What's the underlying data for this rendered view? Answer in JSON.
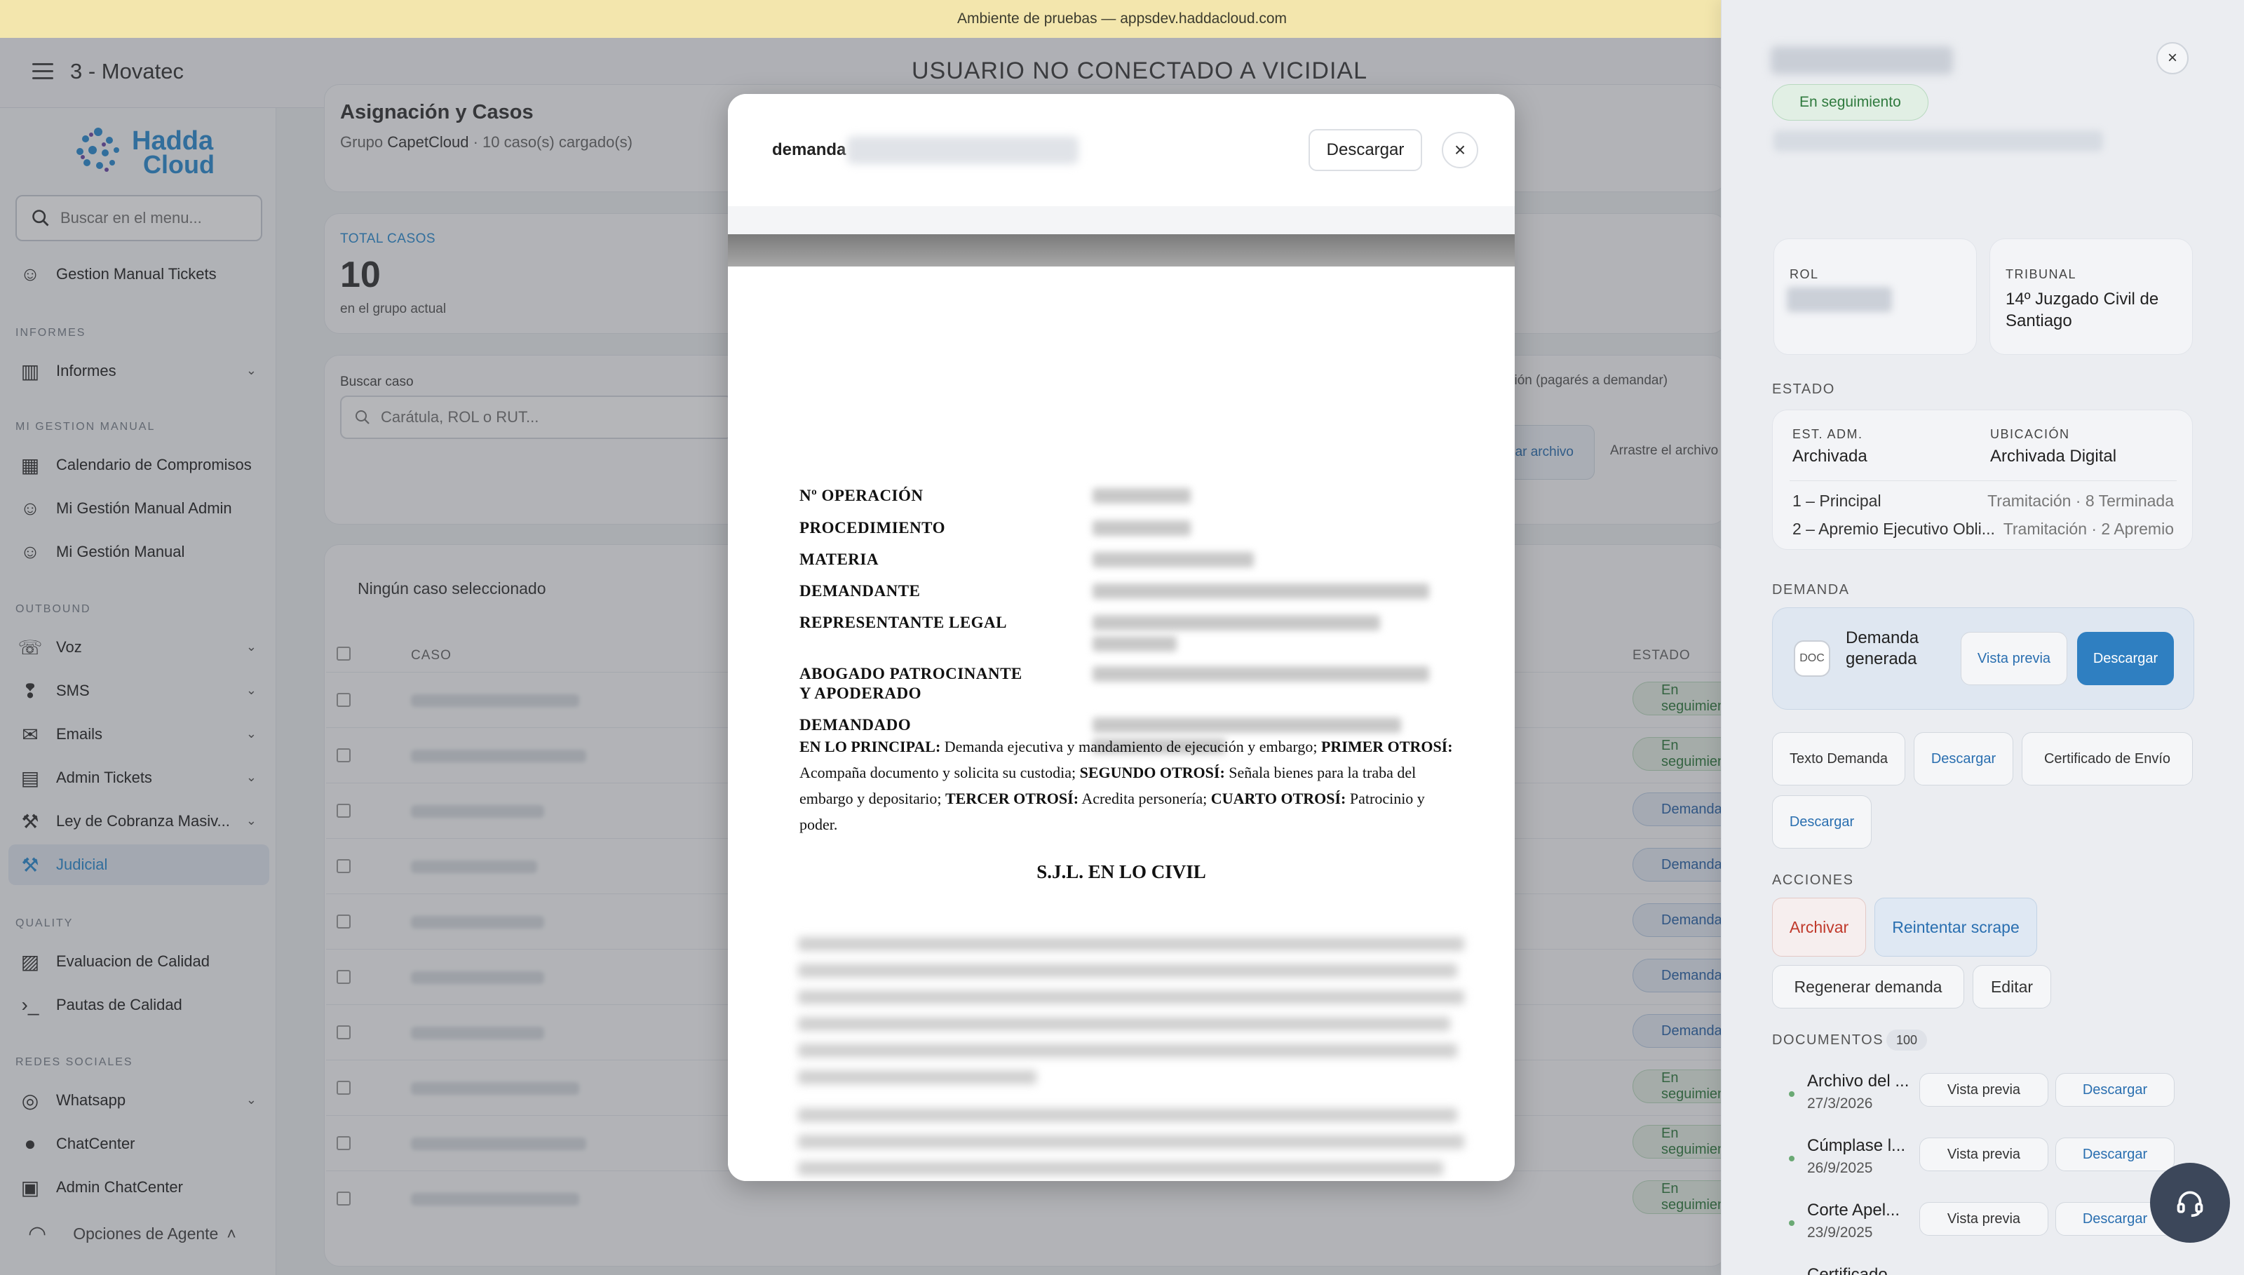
{
  "banner": {
    "text": "Ambiente de pruebas — appsdev.haddacloud.com"
  },
  "header": {
    "org_name": "3 - Movatec",
    "connection_status": "USUARIO NO CONECTADO A VICIDIAL"
  },
  "sidebar": {
    "logo_line1": "Hadda",
    "logo_line2": "Cloud",
    "search_placeholder": "Buscar en el menu...",
    "items": [
      {
        "label": "Gestion Manual Tickets",
        "icon": "headset-icon"
      },
      {
        "section": "INFORMES"
      },
      {
        "label": "Informes",
        "icon": "report-icon",
        "expandable": true
      },
      {
        "section": "MI GESTION MANUAL"
      },
      {
        "label": "Calendario de Compromisos",
        "icon": "calendar-icon"
      },
      {
        "label": "Mi Gestión Manual Admin",
        "icon": "headset-icon"
      },
      {
        "label": "Mi Gestión Manual",
        "icon": "headset-icon"
      },
      {
        "section": "OUTBOUND"
      },
      {
        "label": "Voz",
        "icon": "phone-icon",
        "expandable": true
      },
      {
        "label": "SMS",
        "icon": "chat-alert-icon",
        "expandable": true
      },
      {
        "label": "Emails",
        "icon": "mail-icon",
        "expandable": true
      },
      {
        "label": "Admin Tickets",
        "icon": "ticket-icon",
        "expandable": true
      },
      {
        "label": "Ley de Cobranza Masiv...",
        "icon": "gavel-icon",
        "expandable": true
      },
      {
        "label": "Judicial",
        "icon": "gavel-icon",
        "active": true
      },
      {
        "section": "QUALITY"
      },
      {
        "label": "Evaluacion de Calidad",
        "icon": "clipboard-icon"
      },
      {
        "label": "Pautas de Calidad",
        "icon": "terminal-icon"
      },
      {
        "section": "REDES SOCIALES"
      },
      {
        "label": "Whatsapp",
        "icon": "whatsapp-icon",
        "expandable": true
      },
      {
        "label": "ChatCenter",
        "icon": "chat-icon"
      },
      {
        "label": "Admin ChatCenter",
        "icon": "admin-chat-icon"
      }
    ],
    "agent_options": "Opciones de Agente"
  },
  "main": {
    "title": "Asignación y Casos",
    "subtitle_prefix": "Grupo ",
    "group_name": "CapetCloud",
    "subtitle_suffix": " · 10 caso(s) cargado(s)",
    "total_label": "TOTAL CASOS",
    "total_value": "10",
    "total_sub": "en el grupo actual",
    "search_label": "Buscar caso",
    "search_placeholder": "Carátula, ROL o RUT...",
    "upload_hint": "ción (pagarés a demandar)",
    "upload_button": "nar archivo",
    "drag_hint": "Arrastre el archivo",
    "selection_status": "Ningún caso seleccionado",
    "table_headers": {
      "case": "CASO",
      "status": "ESTADO"
    },
    "rows": [
      {
        "status": "En seguimiento",
        "kind": "seg"
      },
      {
        "status": "En seguimiento",
        "kind": "seg"
      },
      {
        "status": "Demanda",
        "kind": "dem"
      },
      {
        "status": "Demanda",
        "kind": "dem"
      },
      {
        "status": "Demanda",
        "kind": "dem"
      },
      {
        "status": "Demanda",
        "kind": "dem"
      },
      {
        "status": "Demanda",
        "kind": "dem"
      },
      {
        "status": "En seguimiento",
        "kind": "seg"
      },
      {
        "status": "En seguimiento",
        "kind": "seg"
      },
      {
        "status": "En seguimiento",
        "kind": "seg"
      }
    ]
  },
  "modal": {
    "title": "demanda",
    "download_label": "Descargar",
    "close_symbol": "×",
    "document": {
      "fields": [
        "Nº OPERACIÓN",
        "PROCEDIMIENTO",
        "MATERIA",
        "DEMANDANTE",
        "REPRESENTANTE LEGAL",
        "ABOGADO PATROCINANTE",
        "Y APODERADO",
        "DEMANDADO"
      ],
      "p1_b": "EN LO PRINCIPAL:",
      "p1": " Demanda ejecutiva y mandamiento de ejecución y embargo; ",
      "p2_b": "PRIMER OTROSÍ:",
      "p2": " Acompaña documento y solicita su custodia; ",
      "p3_b": "SEGUNDO OTROSÍ:",
      "p3": " Señala bienes para la traba del embargo y depositario; ",
      "p4_b": "TERCER OTROSÍ:",
      "p4": " Acredita personería; ",
      "p5_b": "CUARTO OTROSÍ:",
      "p5": " Patrocinio y poder.",
      "court": "S.J.L. EN LO CIVIL"
    }
  },
  "right_panel": {
    "close_symbol": "×",
    "status_badge": "En seguimiento",
    "rol_label": "ROL",
    "tribunal_label": "TRIBUNAL",
    "tribunal_value": "14º Juzgado Civil de Santiago",
    "estado_section": "ESTADO",
    "est_adm_label": "EST. ADM.",
    "est_adm_value": "Archivada",
    "ubicacion_label": "UBICACIÓN",
    "ubicacion_value": "Archivada Digital",
    "procedures": [
      {
        "name": "1 – Principal",
        "detail": "Tramitación · 8 Terminada"
      },
      {
        "name": "2 – Apremio Ejecutivo Obli...",
        "detail": "Tramitación · 2 Apremio"
      }
    ],
    "demanda_section": "DEMANDA",
    "doc_icon_text": "DOC",
    "demanda_name": "Demanda generada",
    "vista_previa": "Vista previa",
    "descargar": "Descargar",
    "texto_demanda": "Texto Demanda",
    "certificado_envio": "Certificado de Envío",
    "acciones_section": "ACCIONES",
    "archivar": "Archivar",
    "reintentar": "Reintentar scrape",
    "regenerar": "Regenerar demanda",
    "editar": "Editar",
    "documentos_section": "DOCUMENTOS",
    "documentos_count": "100",
    "documents": [
      {
        "name": "Archivo del ...",
        "date": "27/3/2026"
      },
      {
        "name": "Cúmplase l...",
        "date": "26/9/2025"
      },
      {
        "name": "Corte Apel...",
        "date": "23/9/2025"
      },
      {
        "name": "Certificado",
        "date": ""
      }
    ]
  },
  "colors": {
    "accent": "#2a8bd0",
    "primary_button": "#2f7fc1",
    "success": "#2f7a3e",
    "danger": "#c0392b",
    "banner": "#f3e6ad"
  }
}
